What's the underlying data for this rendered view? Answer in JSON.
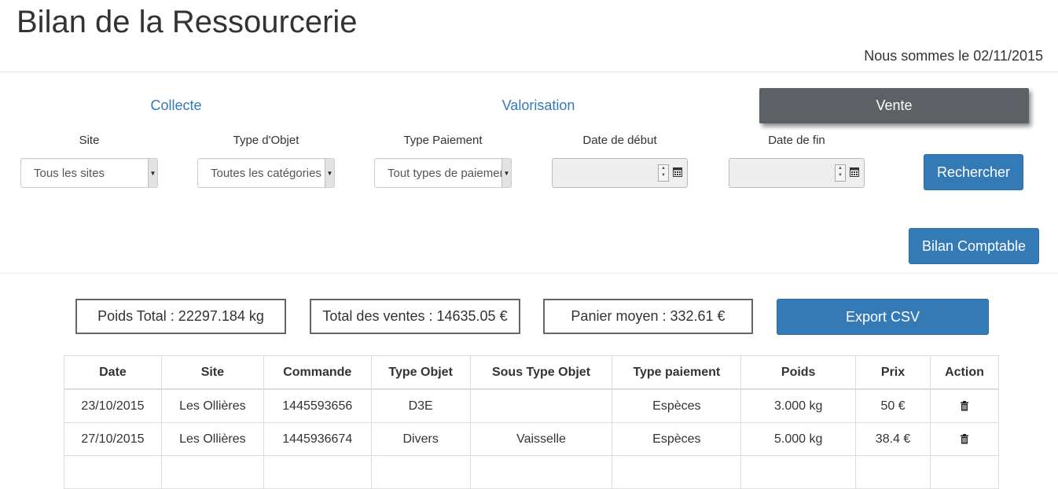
{
  "page": {
    "title": "Bilan de la Ressourcerie",
    "today": "Nous sommes le 02/11/2015"
  },
  "tabs": [
    {
      "label": "Collecte",
      "active": false
    },
    {
      "label": "Valorisation",
      "active": false
    },
    {
      "label": "Vente",
      "active": true
    }
  ],
  "filters": {
    "site": {
      "label": "Site",
      "value": "Tous les sites"
    },
    "type_objet": {
      "label": "Type d'Objet",
      "value": "Toutes les catégories"
    },
    "type_paiement": {
      "label": "Type Paiement",
      "value": "Tout types de paiement"
    },
    "date_debut": {
      "label": "Date de début",
      "value": ""
    },
    "date_fin": {
      "label": "Date de fin",
      "value": ""
    },
    "search_button": "Rechercher",
    "bilan_button": "Bilan Comptable"
  },
  "stats": {
    "poids_total": "Poids Total : 22297.184 kg",
    "total_ventes": "Total des ventes : 14635.05 €",
    "panier_moyen": "Panier moyen : 332.61 €",
    "export_button": "Export CSV"
  },
  "table": {
    "headers": [
      "Date",
      "Site",
      "Commande",
      "Type Objet",
      "Sous Type Objet",
      "Type paiement",
      "Poids",
      "Prix",
      "Action"
    ],
    "rows": [
      [
        "23/10/2015",
        "Les Ollières",
        "1445593656",
        "D3E",
        "",
        "Espèces",
        "3.000 kg",
        "50 €"
      ],
      [
        "27/10/2015",
        "Les Ollières",
        "1445936674",
        "Divers",
        "Vaisselle",
        "Espèces",
        "5.000 kg",
        "38.4 €"
      ]
    ]
  },
  "icons": {
    "select_arrow": "caret-down-icon",
    "date_spinner": "spinner-icon",
    "date_calendar": "calendar-icon",
    "row_action": "trash-icon"
  },
  "colors": {
    "primary": "#337ab7",
    "active_tab": "#5d6166",
    "link": "#337ab7"
  }
}
